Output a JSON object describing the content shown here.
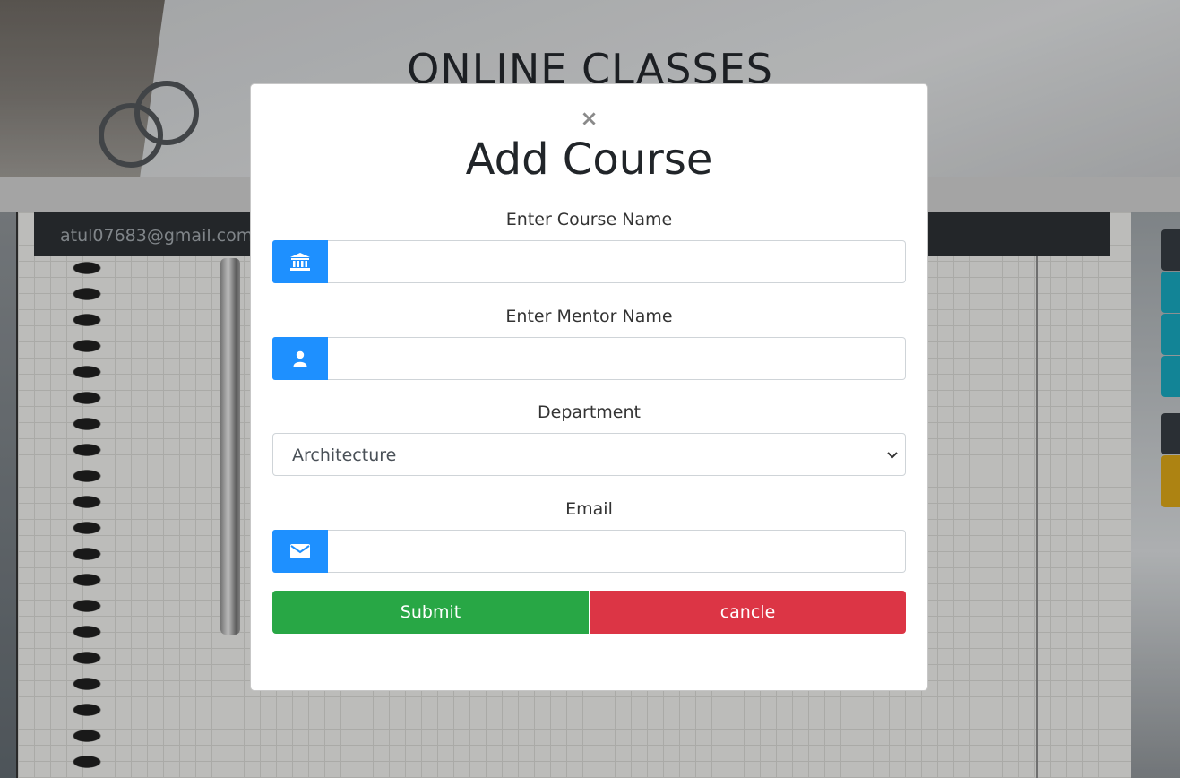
{
  "page": {
    "title": "ONLINE CLASSES",
    "user_email": "atul07683@gmail.com"
  },
  "colors": {
    "icon_bg": "#1e90ff",
    "submit": "#28a745",
    "cancel": "#dc3545",
    "side_tabs": [
      "#343a40",
      "#17a2b8",
      "#17a2b8",
      "#17a2b8",
      "#343a40",
      "#d4a017"
    ]
  },
  "modal": {
    "close_glyph": "×",
    "title": "Add Course",
    "fields": {
      "course_name": {
        "label": "Enter Course Name",
        "value": "",
        "icon": "institution-icon"
      },
      "mentor_name": {
        "label": "Enter Mentor Name",
        "value": "",
        "icon": "user-icon"
      },
      "department": {
        "label": "Department",
        "selected": "Architecture"
      },
      "email": {
        "label": "Email",
        "value": "",
        "icon": "envelope-icon"
      }
    },
    "buttons": {
      "submit": "Submit",
      "cancel": "cancle"
    }
  }
}
